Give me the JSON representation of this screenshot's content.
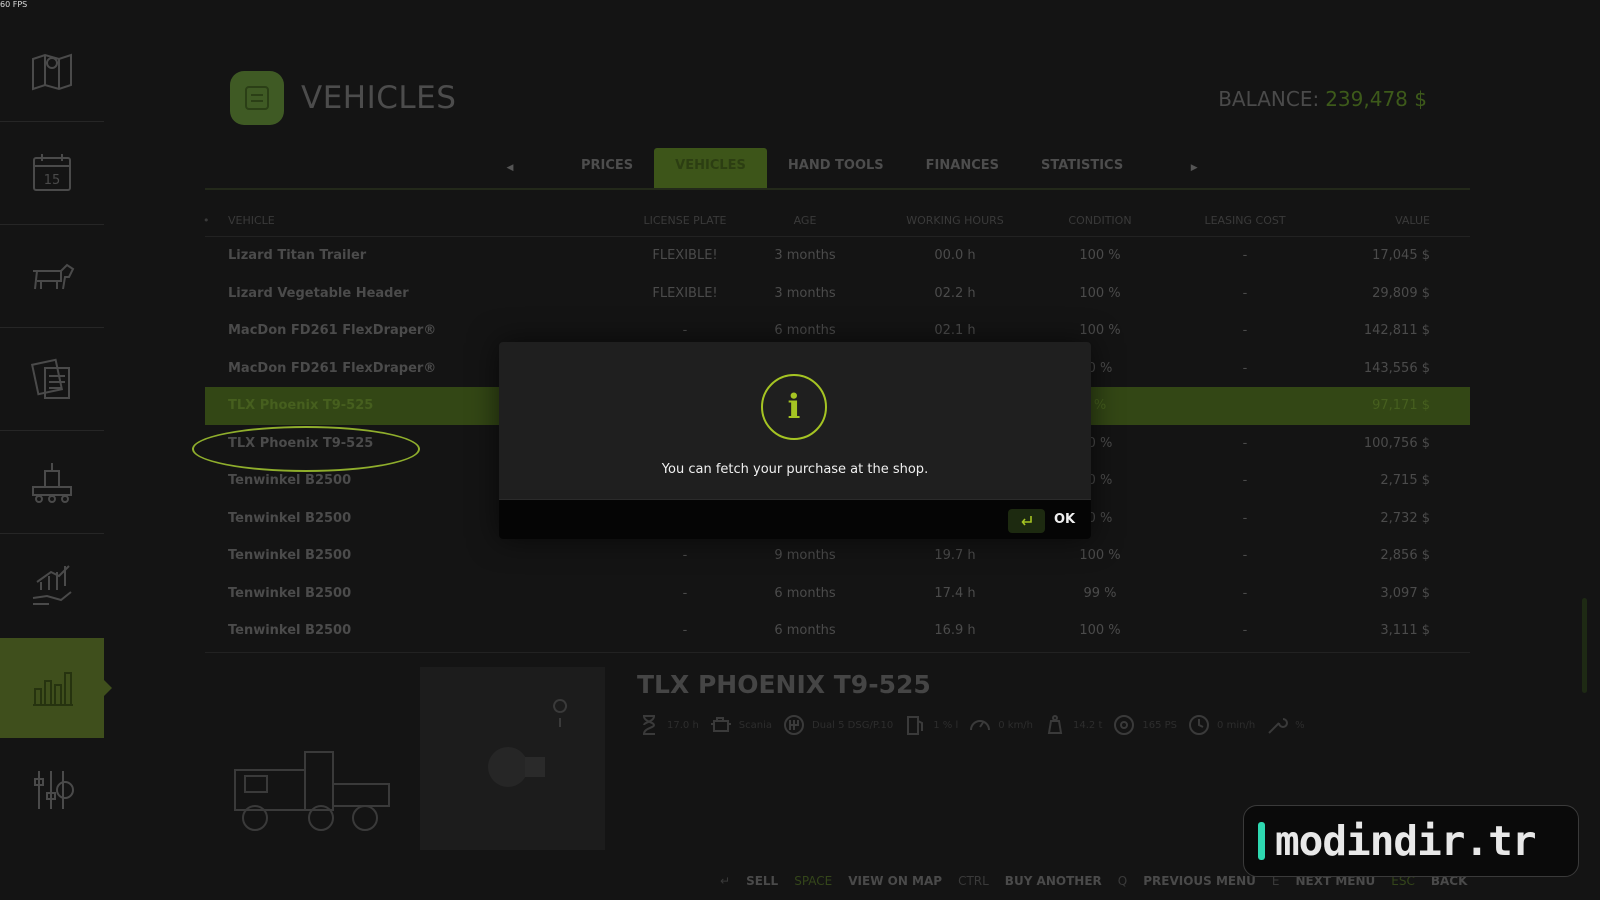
{
  "fps": "60 FPS",
  "header": {
    "title": "VEHICLES",
    "balance_label": "BALANCE:",
    "balance_value": "239,478 $"
  },
  "tabs": [
    "PRICES",
    "VEHICLES",
    "HAND TOOLS",
    "FINANCES",
    "STATISTICS"
  ],
  "active_tab": "VEHICLES",
  "table": {
    "columns": [
      "VEHICLE",
      "LICENSE PLATE",
      "AGE",
      "WORKING HOURS",
      "CONDITION",
      "LEASING COST",
      "VALUE"
    ],
    "rows": [
      {
        "name": "Lizard Titan Trailer",
        "plate": "FLEXIBLE!",
        "age": "3 months",
        "hours": "00.0 h",
        "condition": "100 %",
        "lease": "-",
        "value": "17,045 $"
      },
      {
        "name": "Lizard Vegetable Header",
        "plate": "FLEXIBLE!",
        "age": "3 months",
        "hours": "02.2 h",
        "condition": "100 %",
        "lease": "-",
        "value": "29,809 $"
      },
      {
        "name": "MacDon FD261 FlexDraper®",
        "plate": "-",
        "age": "6 months",
        "hours": "02.1 h",
        "condition": "100 %",
        "lease": "-",
        "value": "142,811 $"
      },
      {
        "name": "MacDon FD261 FlexDraper®",
        "plate": "",
        "age": "",
        "hours": "",
        "condition": "0 %",
        "lease": "-",
        "value": "143,556 $"
      },
      {
        "name": "TLX Phoenix T9-525",
        "plate": "",
        "age": "",
        "hours": "",
        "condition": "%",
        "lease": "",
        "value": "97,171 $"
      },
      {
        "name": "TLX Phoenix T9-525",
        "plate": "",
        "age": "",
        "hours": "",
        "condition": "0 %",
        "lease": "-",
        "value": "100,756 $"
      },
      {
        "name": "Tenwinkel B2500",
        "plate": "",
        "age": "",
        "hours": "",
        "condition": "0 %",
        "lease": "-",
        "value": "2,715 $"
      },
      {
        "name": "Tenwinkel B2500",
        "plate": "",
        "age": "",
        "hours": "",
        "condition": "0 %",
        "lease": "-",
        "value": "2,732 $"
      },
      {
        "name": "Tenwinkel B2500",
        "plate": "-",
        "age": "9 months",
        "hours": "19.7 h",
        "condition": "100 %",
        "lease": "-",
        "value": "2,856 $"
      },
      {
        "name": "Tenwinkel B2500",
        "plate": "-",
        "age": "6 months",
        "hours": "17.4 h",
        "condition": "99 %",
        "lease": "-",
        "value": "3,097 $"
      },
      {
        "name": "Tenwinkel B2500",
        "plate": "-",
        "age": "6 months",
        "hours": "16.9 h",
        "condition": "100 %",
        "lease": "-",
        "value": "3,111 $"
      }
    ],
    "highlighted_row": 4
  },
  "detail": {
    "title": "TLX PHOENIX T9-525",
    "specs": [
      {
        "icon": "hourglass-icon",
        "text": "17.0 h"
      },
      {
        "icon": "engine-icon",
        "text": "Scania"
      },
      {
        "icon": "gearbox-icon",
        "text": "Dual 5 DSG/P.10"
      },
      {
        "icon": "fuel-icon",
        "text": "1 % l"
      },
      {
        "icon": "speed-icon",
        "text": "0 km/h"
      },
      {
        "icon": "weight-icon",
        "text": "14.2 t"
      },
      {
        "icon": "wheel-icon",
        "text": "165 PS"
      },
      {
        "icon": "timer-icon",
        "text": "0 min/h"
      },
      {
        "icon": "wrench-icon",
        "text": "%"
      }
    ]
  },
  "footer": [
    {
      "key": "↵",
      "label": "SELL"
    },
    {
      "key": "SPACE",
      "label": "VIEW ON MAP"
    },
    {
      "key": "CTRL",
      "label": "BUY ANOTHER"
    },
    {
      "key": "Q",
      "label": "PREVIOUS MENU"
    },
    {
      "key": "E",
      "label": "NEXT MENU"
    },
    {
      "key": "ESC",
      "label": "BACK"
    }
  ],
  "dialog": {
    "icon": "info-icon",
    "icon_glyph": "i",
    "message": "You can fetch your purchase at the shop.",
    "ok_label": "OK"
  },
  "watermark": "modindir.tr",
  "colors": {
    "accent": "#a5c423",
    "highlight_row": "#334715",
    "watermark_bar": "#2ed8b0"
  }
}
